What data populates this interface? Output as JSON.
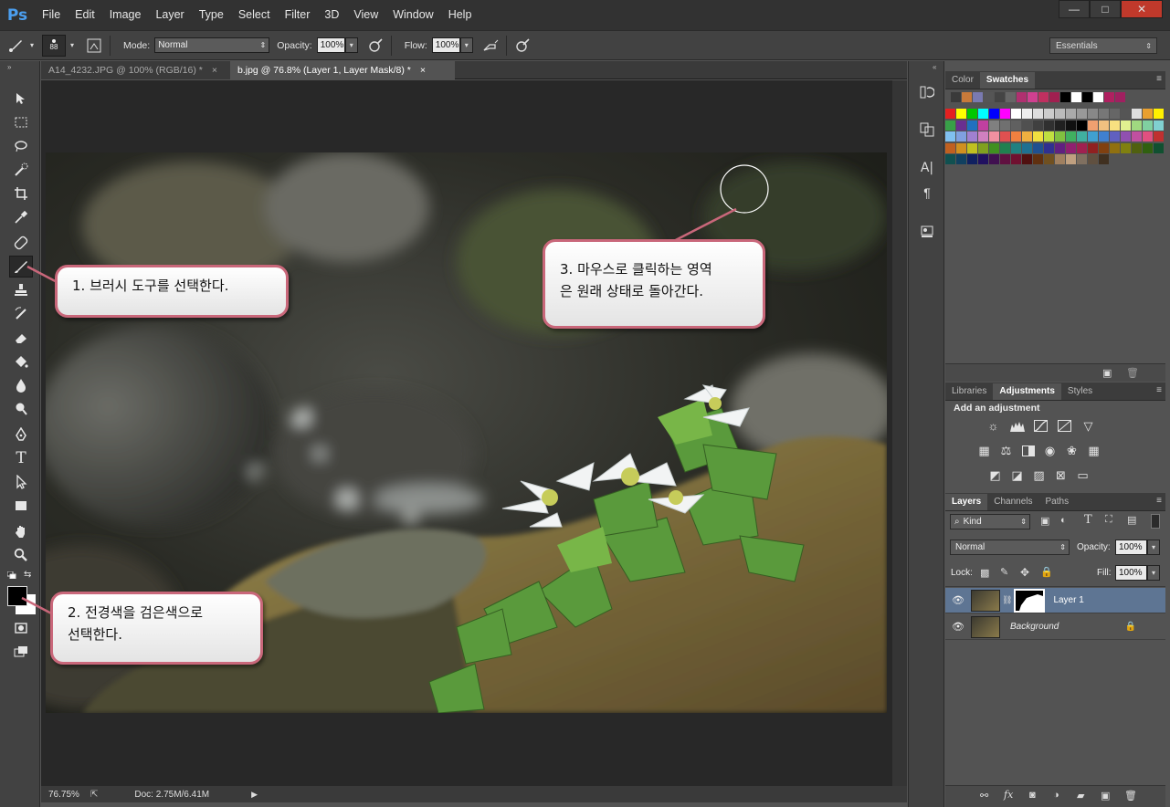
{
  "app": {
    "logo": "Ps"
  },
  "menu": [
    "File",
    "Edit",
    "Image",
    "Layer",
    "Type",
    "Select",
    "Filter",
    "3D",
    "View",
    "Window",
    "Help"
  ],
  "window_controls": {
    "minimize": "—",
    "maximize": "□",
    "close": "✕"
  },
  "options_bar": {
    "brush_size": "88",
    "mode_label": "Mode:",
    "mode_value": "Normal",
    "opacity_label": "Opacity:",
    "opacity_value": "100%",
    "flow_label": "Flow:",
    "flow_value": "100%",
    "workspace": "Essentials"
  },
  "tabs": [
    {
      "label": "A14_4232.JPG @ 100% (RGB/16) *",
      "close": "×",
      "active": false
    },
    {
      "label": "b.jpg @ 76.8% (Layer 1, Layer Mask/8) *",
      "close": "×",
      "active": true
    }
  ],
  "status": {
    "zoom": "76.75%",
    "doc": "Doc: 2.75M/6.41M"
  },
  "color_panel": {
    "tabs": [
      "Color",
      "Swatches"
    ],
    "active": "Swatches"
  },
  "adjust_panel": {
    "tabs": [
      "Libraries",
      "Adjustments",
      "Styles"
    ],
    "active": "Adjustments",
    "heading": "Add an adjustment"
  },
  "layers_panel": {
    "tabs": [
      "Layers",
      "Channels",
      "Paths"
    ],
    "active": "Layers",
    "filter_kind": "Kind",
    "blend_mode": "Normal",
    "opacity_label": "Opacity:",
    "opacity_value": "100%",
    "lock_label": "Lock:",
    "fill_label": "Fill:",
    "fill_value": "100%",
    "layers": [
      {
        "name": "Layer 1",
        "selected": true
      },
      {
        "name": "Background",
        "selected": false,
        "locked": true
      }
    ]
  },
  "callouts": {
    "c1": {
      "line1": "1. 브러시 도구를 선택한다."
    },
    "c2": {
      "line1": "2. 전경색을 검은색으로",
      "line2": "선택한다."
    },
    "c3": {
      "line1": "3. 마우스로 클릭하는 영역",
      "line2": "은 원래 상태로 돌아간다."
    }
  },
  "colors": {
    "accent_callout": "#c9677a",
    "panel_bg": "#535353",
    "selected_layer": "#5e7593"
  }
}
